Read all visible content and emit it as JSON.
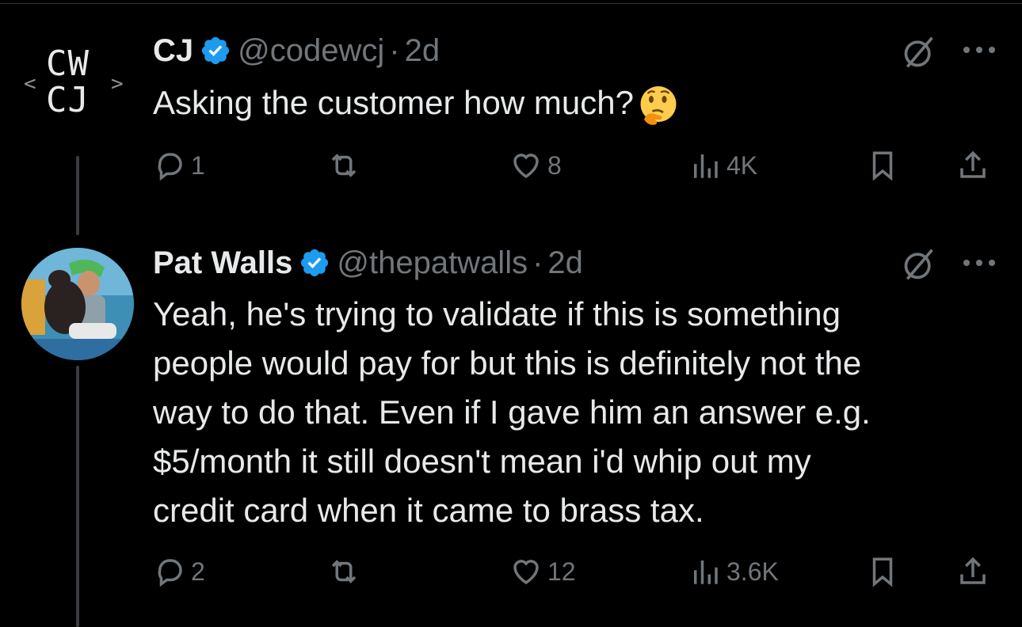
{
  "tweets": [
    {
      "author": "CJ",
      "handle": "@codewcj",
      "time": "2d",
      "verified": true,
      "avatar_icon": "cw-cj-logo",
      "avatar_text_top": "CW",
      "avatar_text_bottom": "CJ",
      "text": "Asking the customer how much?",
      "emoji": "thinking-face",
      "replies": "1",
      "reposts": "",
      "likes": "8",
      "views": "4K"
    },
    {
      "author": "Pat Walls",
      "handle": "@thepatwalls",
      "time": "2d",
      "verified": true,
      "avatar_icon": "profile-photo",
      "text_lines": [
        "Yeah, he's trying to validate if this is something",
        "people would pay for but this is definitely not the",
        "way to do that. Even if I gave him an answer e.g.",
        "$5/month it still doesn't mean i'd whip out my",
        "credit card when it came to brass tax."
      ],
      "replies": "2",
      "reposts": "",
      "likes": "12",
      "views": "3.6K"
    }
  ],
  "colors": {
    "background": "#000000",
    "text": "#e7e9ea",
    "secondary": "#71767b",
    "verified": "#1d9bf0",
    "thread_line": "#3a3d41"
  }
}
